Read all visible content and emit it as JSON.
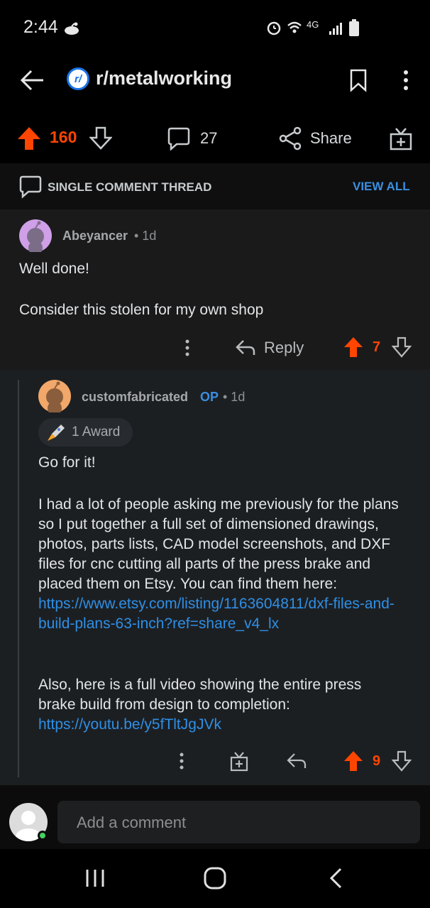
{
  "status_bar": {
    "time": "2:44",
    "indicators": "4G"
  },
  "header": {
    "subreddit": "r/metalworking",
    "logo_letter": "r/"
  },
  "post_actions": {
    "score": "160",
    "comments": "27",
    "share_label": "Share"
  },
  "thread_bar": {
    "label": "SINGLE COMMENT THREAD",
    "view_all": "VIEW ALL"
  },
  "comments": [
    {
      "author": "Abeyancer",
      "age": "• 1d",
      "lines": [
        "Well done!",
        "Consider this stolen for my own shop"
      ],
      "reply_label": "Reply",
      "score": "7"
    },
    {
      "author": "customfabricated",
      "op_badge": "OP",
      "age": "• 1d",
      "award": "1 Award",
      "p1": "Go for it!",
      "p2_text": "I had a lot of people asking me previously for the plans so I put together a full set of dimensioned drawings, photos, parts lists, CAD model screenshots, and DXF files for cnc cutting all parts of the press brake and placed them on Etsy. You can find them here: ",
      "p2_link": "https://www.etsy.com/listing/1163604811/dxf-files-and-build-plans-63-inch?ref=share_v4_lx",
      "p3_text": "Also, here is a full video showing the entire press brake build from design to completion: ",
      "p3_link": "https://youtu.be/y5fTltJgJVk",
      "score": "9"
    }
  ],
  "composer": {
    "placeholder": "Add a comment"
  },
  "colors": {
    "upvote": "#ff4500",
    "link": "#2f8fe6",
    "background": "#000000",
    "card": "#1a1a1b"
  }
}
